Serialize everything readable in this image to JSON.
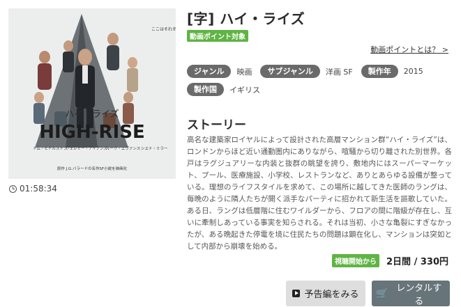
{
  "title": "[字] ハイ・ライズ",
  "points_badge": "動画ポイント対象",
  "points_link": "動画ポイントとは？ >",
  "meta": {
    "genre_label": "ジャンル",
    "genre_value": "映画",
    "subgenre_label": "サブジャンル",
    "subgenre_value": "洋画 SF",
    "year_label": "製作年",
    "year_value": "2015",
    "country_label": "製作国",
    "country_value": "イギリス"
  },
  "duration": "01:58:34",
  "story": {
    "heading": "ストーリー",
    "text": "高名な建築家ロイヤルによって設計された高層マンション群“ハイ・ライズ”は、ロンドンからほど近い通勤圏内にありながら、喧騒から切り離された別世界。各戸はラグジュアリーな内装と抜群の眺望を誇り、敷地内にはスーパーマーケット、プール、医療施設、小学校、レストランなど、ありとあらゆる設備が整っている。理想のライフスタイルを求めて、この場所に越してきた医師のラングは、毎晩のように隣人たちが開く派手なパーティに招かれて新生活を謳歌していた。ある日、ラングは低層階に住むワイルダーから、フロアの間に階級が存在し、互いに牽制しあっている事実を知らされる。それは当初、小さな亀裂にすぎなかったが、ある晩起きた停電を境に住民たちの問題は顕在化し、マンションは突如として内部から崩壊を始める。"
  },
  "price": {
    "start_badge": "視聴開始から",
    "text": "2日間 / 330円"
  },
  "buttons": {
    "trailer": "予告編をみる",
    "rent": "レンタルする"
  },
  "poster": {
    "tagline": "ここはそれぞれのマンション、一度住めば帰れるのは…",
    "title_jp": "ハイ・ライズ",
    "title_en": "HIGH-RISE",
    "cast": [
      "トム・ヒドルストン",
      "ジェレミー・アイアンズ",
      "ルーク・エヴァンス",
      "シエナ・ミラー"
    ],
    "credit": "原作 J.G.バラードの名作SF小説を映画化"
  },
  "colors": {
    "accent_green": "#5fb443",
    "pill_gray": "#6a6a6a",
    "rent_button": "#67747a",
    "trailer_button": "#dedede"
  }
}
